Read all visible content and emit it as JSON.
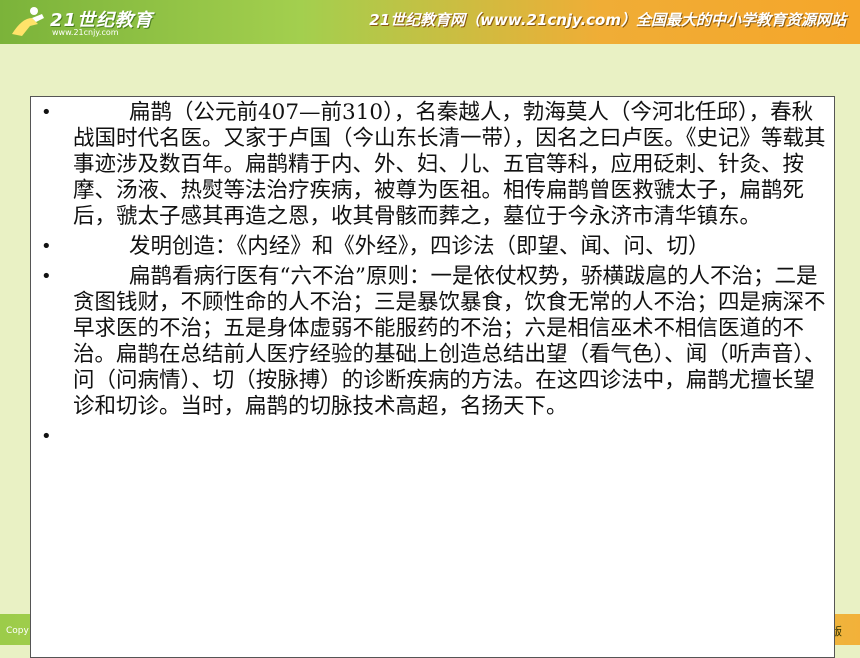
{
  "header": {
    "logo_text": "21世纪教育",
    "logo_url": "www.21cnjy.com",
    "slogan": "21世纪教育网（www.21cnjy.com）全国最大的中小学教育资源网站"
  },
  "content": {
    "paragraphs": [
      "扁鹊（公元前407—前310），名秦越人，勃海莫人（今河北任邱），春秋战国时代名医。又家于卢国（今山东长清一带），因名之曰卢医。《史记》等载其事迹涉及数百年。扁鹊精于内、外、妇、儿、五官等科，应用砭刺、针灸、按摩、汤液、热熨等法治疗疾病，被尊为医祖。相传扁鹊曾医救虢太子，扁鹊死后，虢太子感其再造之恩，收其骨骸而葬之，墓位于今永济市清华镇东。",
      "发明创造：《内经》和《外经》，四诊法（即望、闻、问、切）",
      "扁鹊看病行医有“六不治”原则：一是依仗权势，骄横跋扈的人不治；二是贪图钱财，不顾性命的人不治；三是暴饮暴食，饮食无常的人不治；四是病深不早求医的不治；五是身体虚弱不能服药的不治；六是相信巫术不相信医道的不治。扁鹊在总结前人医疗经验的基础上创造总结出望（看气色）、闻（听声音）、问（问病情）、切（按脉搏）的诊断疾病的方法。在这四诊法中，扁鹊尤擅长望诊和切诊。当时，扁鹊的切脉技术高超，名扬天下。",
      ""
    ],
    "bullet_char": "•"
  },
  "footer": {
    "left_text": "Copy",
    "right_text": "版"
  }
}
